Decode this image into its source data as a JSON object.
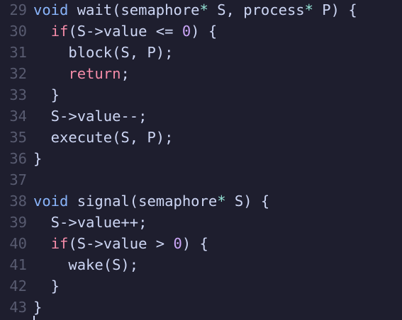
{
  "editor": {
    "lines": [
      {
        "no": "29",
        "tokens": [
          {
            "t": "void",
            "c": "kw"
          },
          {
            "t": " wait(semaphore"
          },
          {
            "t": "*",
            "c": "op"
          },
          {
            "t": " S, process"
          },
          {
            "t": "*",
            "c": "op"
          },
          {
            "t": " P) {"
          }
        ]
      },
      {
        "no": "30",
        "tokens": [
          {
            "t": "  "
          },
          {
            "t": "if",
            "c": "ctl"
          },
          {
            "t": "(S->value <= "
          },
          {
            "t": "0",
            "c": "num"
          },
          {
            "t": ") {"
          }
        ]
      },
      {
        "no": "31",
        "tokens": [
          {
            "t": "    block(S, P);"
          }
        ]
      },
      {
        "no": "32",
        "tokens": [
          {
            "t": "    "
          },
          {
            "t": "return",
            "c": "ctl"
          },
          {
            "t": ";"
          }
        ]
      },
      {
        "no": "33",
        "tokens": [
          {
            "t": "  }"
          }
        ]
      },
      {
        "no": "34",
        "tokens": [
          {
            "t": "  S->value--;"
          }
        ]
      },
      {
        "no": "35",
        "tokens": [
          {
            "t": "  execute(S, P);"
          }
        ]
      },
      {
        "no": "36",
        "tokens": [
          {
            "t": "}"
          }
        ]
      },
      {
        "no": "37",
        "tokens": []
      },
      {
        "no": "38",
        "tokens": [
          {
            "t": "void",
            "c": "kw"
          },
          {
            "t": " signal(semaphore"
          },
          {
            "t": "*",
            "c": "op"
          },
          {
            "t": " S) {"
          }
        ]
      },
      {
        "no": "39",
        "tokens": [
          {
            "t": "  S->value++;"
          }
        ]
      },
      {
        "no": "40",
        "tokens": [
          {
            "t": "  "
          },
          {
            "t": "if",
            "c": "ctl"
          },
          {
            "t": "(S->value > "
          },
          {
            "t": "0",
            "c": "num"
          },
          {
            "t": ") {"
          }
        ]
      },
      {
        "no": "41",
        "tokens": [
          {
            "t": "    wake(S);"
          }
        ]
      },
      {
        "no": "42",
        "tokens": [
          {
            "t": "  }"
          }
        ]
      },
      {
        "no": "43",
        "tokens": [
          {
            "t": "}"
          }
        ]
      }
    ]
  },
  "theme": {
    "background": "#1e1e2e",
    "text": "#cdd6f4",
    "line_number": "#585b70",
    "keyword": "#89b4fa",
    "control": "#f38ba8",
    "number": "#cba6f7"
  }
}
